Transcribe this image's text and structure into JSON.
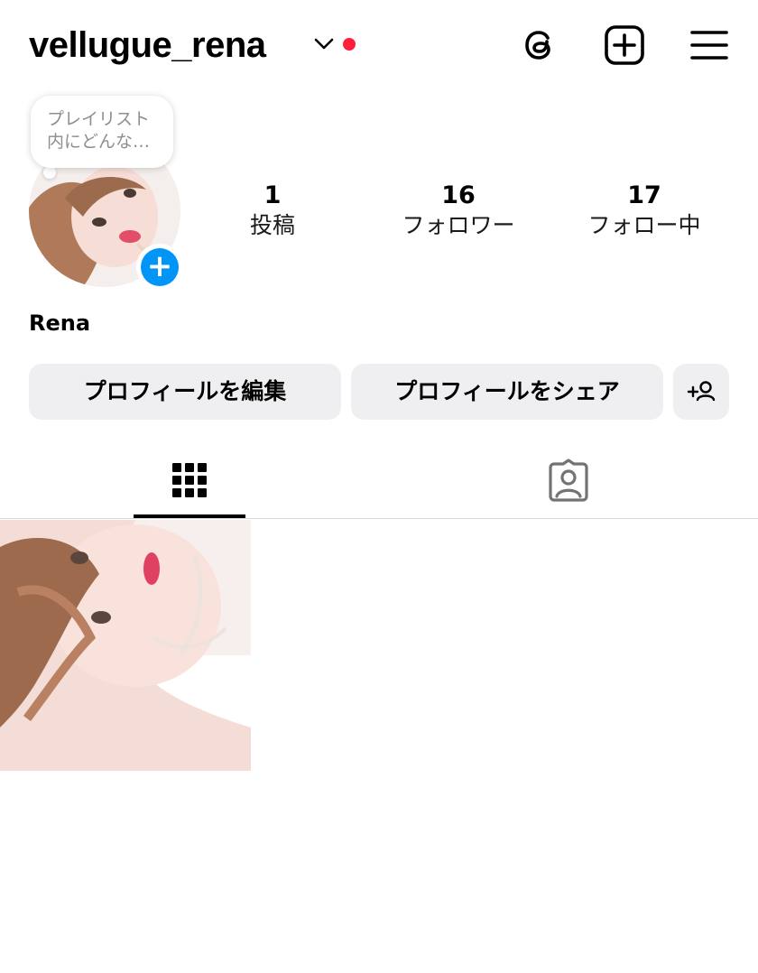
{
  "header": {
    "username": "vellugue_rena",
    "account_switch_icon": "chevron-down-icon",
    "notification_dot_color": "#ff1e3c",
    "icons": [
      "threads-icon",
      "create-post-icon",
      "menu-icon"
    ]
  },
  "profile": {
    "note_text": "プレイリスト\n内にどんな…",
    "full_name": "Rena",
    "add_story_label": "+",
    "stats": [
      {
        "value": "1",
        "label": "投稿"
      },
      {
        "value": "16",
        "label": "フォロワー"
      },
      {
        "value": "17",
        "label": "フォロー中"
      }
    ]
  },
  "actions": {
    "edit_profile": "プロフィールを編集",
    "share_profile": "プロフィールをシェア",
    "discover_people_icon": "add-person-icon"
  },
  "tabs": [
    {
      "icon": "grid-icon",
      "active": true
    },
    {
      "icon": "tagged-icon",
      "active": false
    }
  ],
  "posts": [
    {
      "thumbnail": "photo"
    }
  ],
  "colors": {
    "accent": "#0095f6",
    "button_bg": "#efeff2"
  }
}
